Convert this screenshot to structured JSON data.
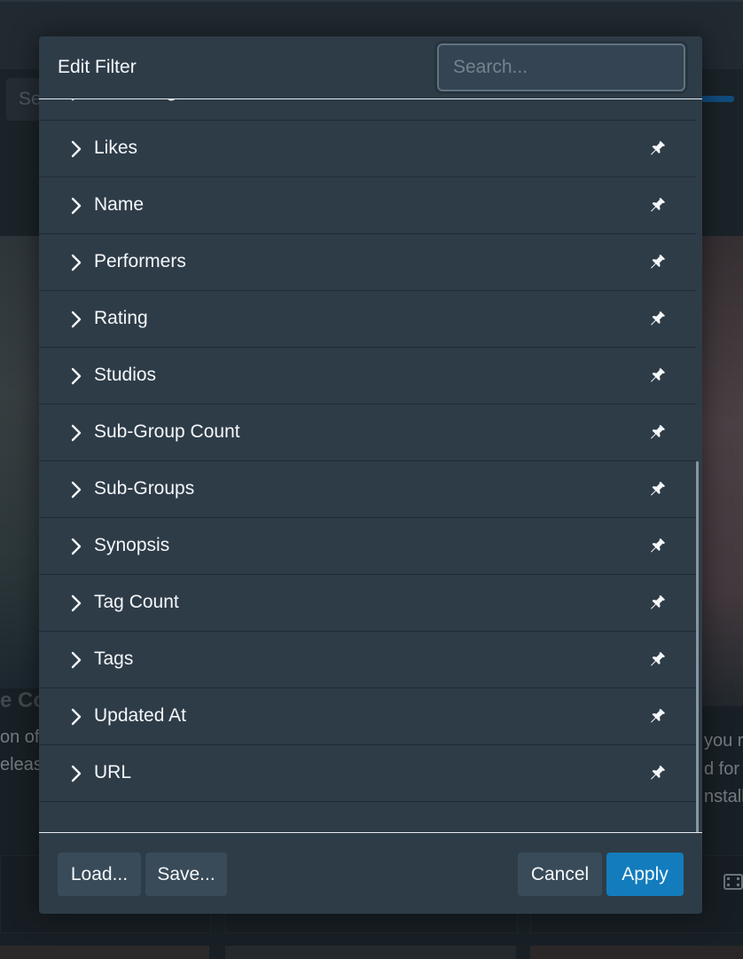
{
  "background": {
    "search_placeholder": "Se",
    "left_card_title": "e Co",
    "left_card_lines": [
      "on of",
      "eleas"
    ],
    "right_card_lines": [
      "you r",
      "d for",
      "nstall"
    ]
  },
  "modal": {
    "title": "Edit Filter",
    "search": {
      "placeholder": "Search...",
      "value": ""
    },
    "criteria": [
      {
        "label": "Is Missing",
        "icon": "chevron-right-icon",
        "pin_icon": "pin-icon"
      },
      {
        "label": "Likes",
        "icon": "chevron-right-icon",
        "pin_icon": "pin-icon"
      },
      {
        "label": "Name",
        "icon": "chevron-right-icon",
        "pin_icon": "pin-icon"
      },
      {
        "label": "Performers",
        "icon": "chevron-right-icon",
        "pin_icon": "pin-icon"
      },
      {
        "label": "Rating",
        "icon": "chevron-right-icon",
        "pin_icon": "pin-icon"
      },
      {
        "label": "Studios",
        "icon": "chevron-right-icon",
        "pin_icon": "pin-icon"
      },
      {
        "label": "Sub-Group Count",
        "icon": "chevron-right-icon",
        "pin_icon": "pin-icon"
      },
      {
        "label": "Sub-Groups",
        "icon": "chevron-right-icon",
        "pin_icon": "pin-icon"
      },
      {
        "label": "Synopsis",
        "icon": "chevron-right-icon",
        "pin_icon": "pin-icon"
      },
      {
        "label": "Tag Count",
        "icon": "chevron-right-icon",
        "pin_icon": "pin-icon"
      },
      {
        "label": "Tags",
        "icon": "chevron-right-icon",
        "pin_icon": "pin-icon"
      },
      {
        "label": "Updated At",
        "icon": "chevron-right-icon",
        "pin_icon": "pin-icon"
      },
      {
        "label": "URL",
        "icon": "chevron-right-icon",
        "pin_icon": "pin-icon"
      }
    ],
    "footer": {
      "load_label": "Load...",
      "save_label": "Save...",
      "cancel_label": "Cancel",
      "apply_label": "Apply"
    }
  },
  "colors": {
    "modal_bg": "#2e3c48",
    "primary": "#137cbd",
    "secondary_button": "#394b59",
    "text": "#f5f8fa"
  }
}
